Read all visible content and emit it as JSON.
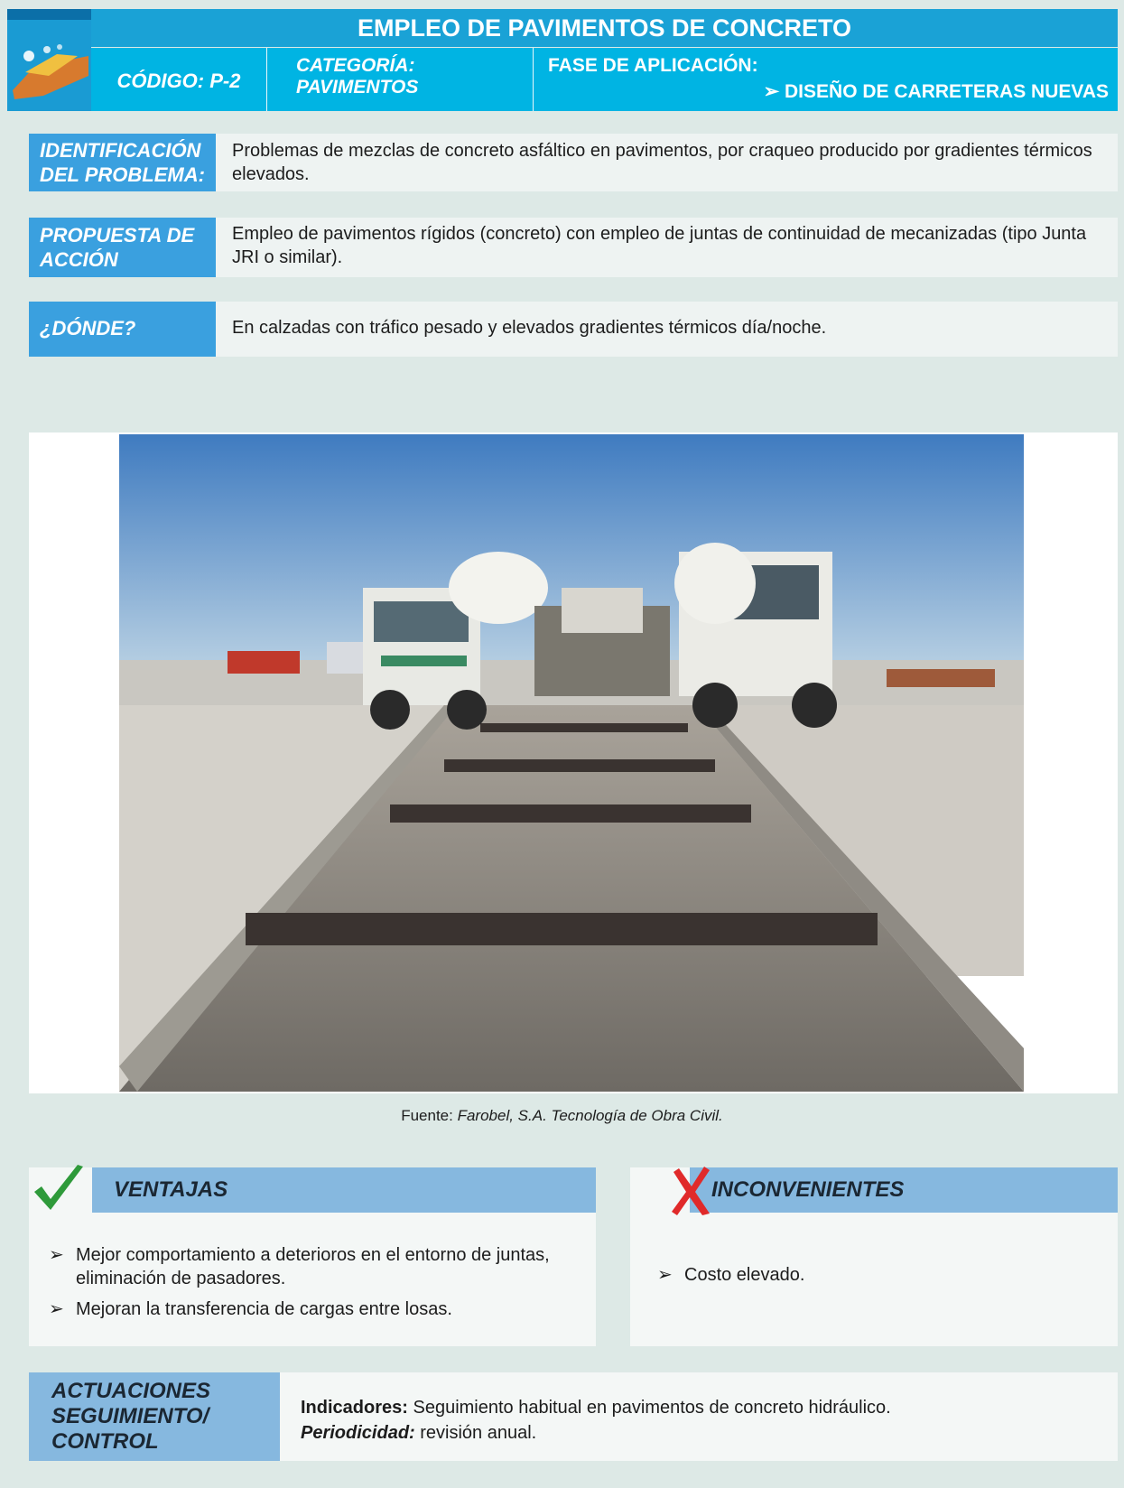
{
  "header": {
    "title": "EMPLEO DE PAVIMENTOS DE CONCRETO",
    "code": "CÓDIGO: P-2",
    "category_line1": "CATEGORÍA:",
    "category_line2": "PAVIMENTOS",
    "phase_label": "FASE DE APLICACIÓN:",
    "phase_value": "➢  DISEÑO DE CARRETERAS NUEVAS"
  },
  "rows": [
    {
      "label_line1": "IDENTIFICACIÓN",
      "label_line2": "DEL PROBLEMA:",
      "text": "Problemas de mezclas de concreto asfáltico en pavimentos, por craqueo producido por gradientes térmicos elevados."
    },
    {
      "label_line1": "PROPUESTA DE",
      "label_line2": "ACCIÓN",
      "text": "Empleo de pavimentos rígidos (concreto) con empleo de juntas de continuidad de mecanizadas (tipo Junta JRI o similar)."
    },
    {
      "label_line1": "¿DÓNDE?",
      "label_line2": "",
      "text": "En calzadas con tráfico pesado y elevados gradientes térmicos día/noche."
    }
  ],
  "photo": {
    "caption_prefix": "Fuente: ",
    "caption_source": "Farobel, S.A. Tecnología de Obra Civil."
  },
  "advantages": {
    "title": "VENTAJAS",
    "items": [
      "Mejor comportamiento a deterioros en el entorno de juntas, eliminación de pasadores.",
      "Mejoran la transferencia de cargas entre losas."
    ]
  },
  "disadvantages": {
    "title": "INCONVENIENTES",
    "items": [
      "Costo elevado."
    ]
  },
  "control": {
    "label_line1": "ACTUACIONES",
    "label_line2": "SEGUIMIENTO/",
    "label_line3": "CONTROL",
    "indicators_label": "Indicadores:",
    "indicators_text": " Seguimiento habitual en pavimentos de concreto hidráulico.",
    "periodicity_label": "Periodicidad:",
    "periodicity_text": " revisión anual."
  },
  "icons": {
    "header_logo": "road-construction-icon",
    "advantages": "check-icon",
    "disadvantages": "cross-icon",
    "bullet": "arrow-bullet-icon"
  },
  "colors": {
    "title_bar": "#1aa2d6",
    "header_row": "#00b4e3",
    "label_blue": "#3aa0df",
    "panel_head": "#86b8df",
    "check_green": "#2e9a3a",
    "cross_red": "#e02a2a",
    "background": "#dde9e6"
  }
}
